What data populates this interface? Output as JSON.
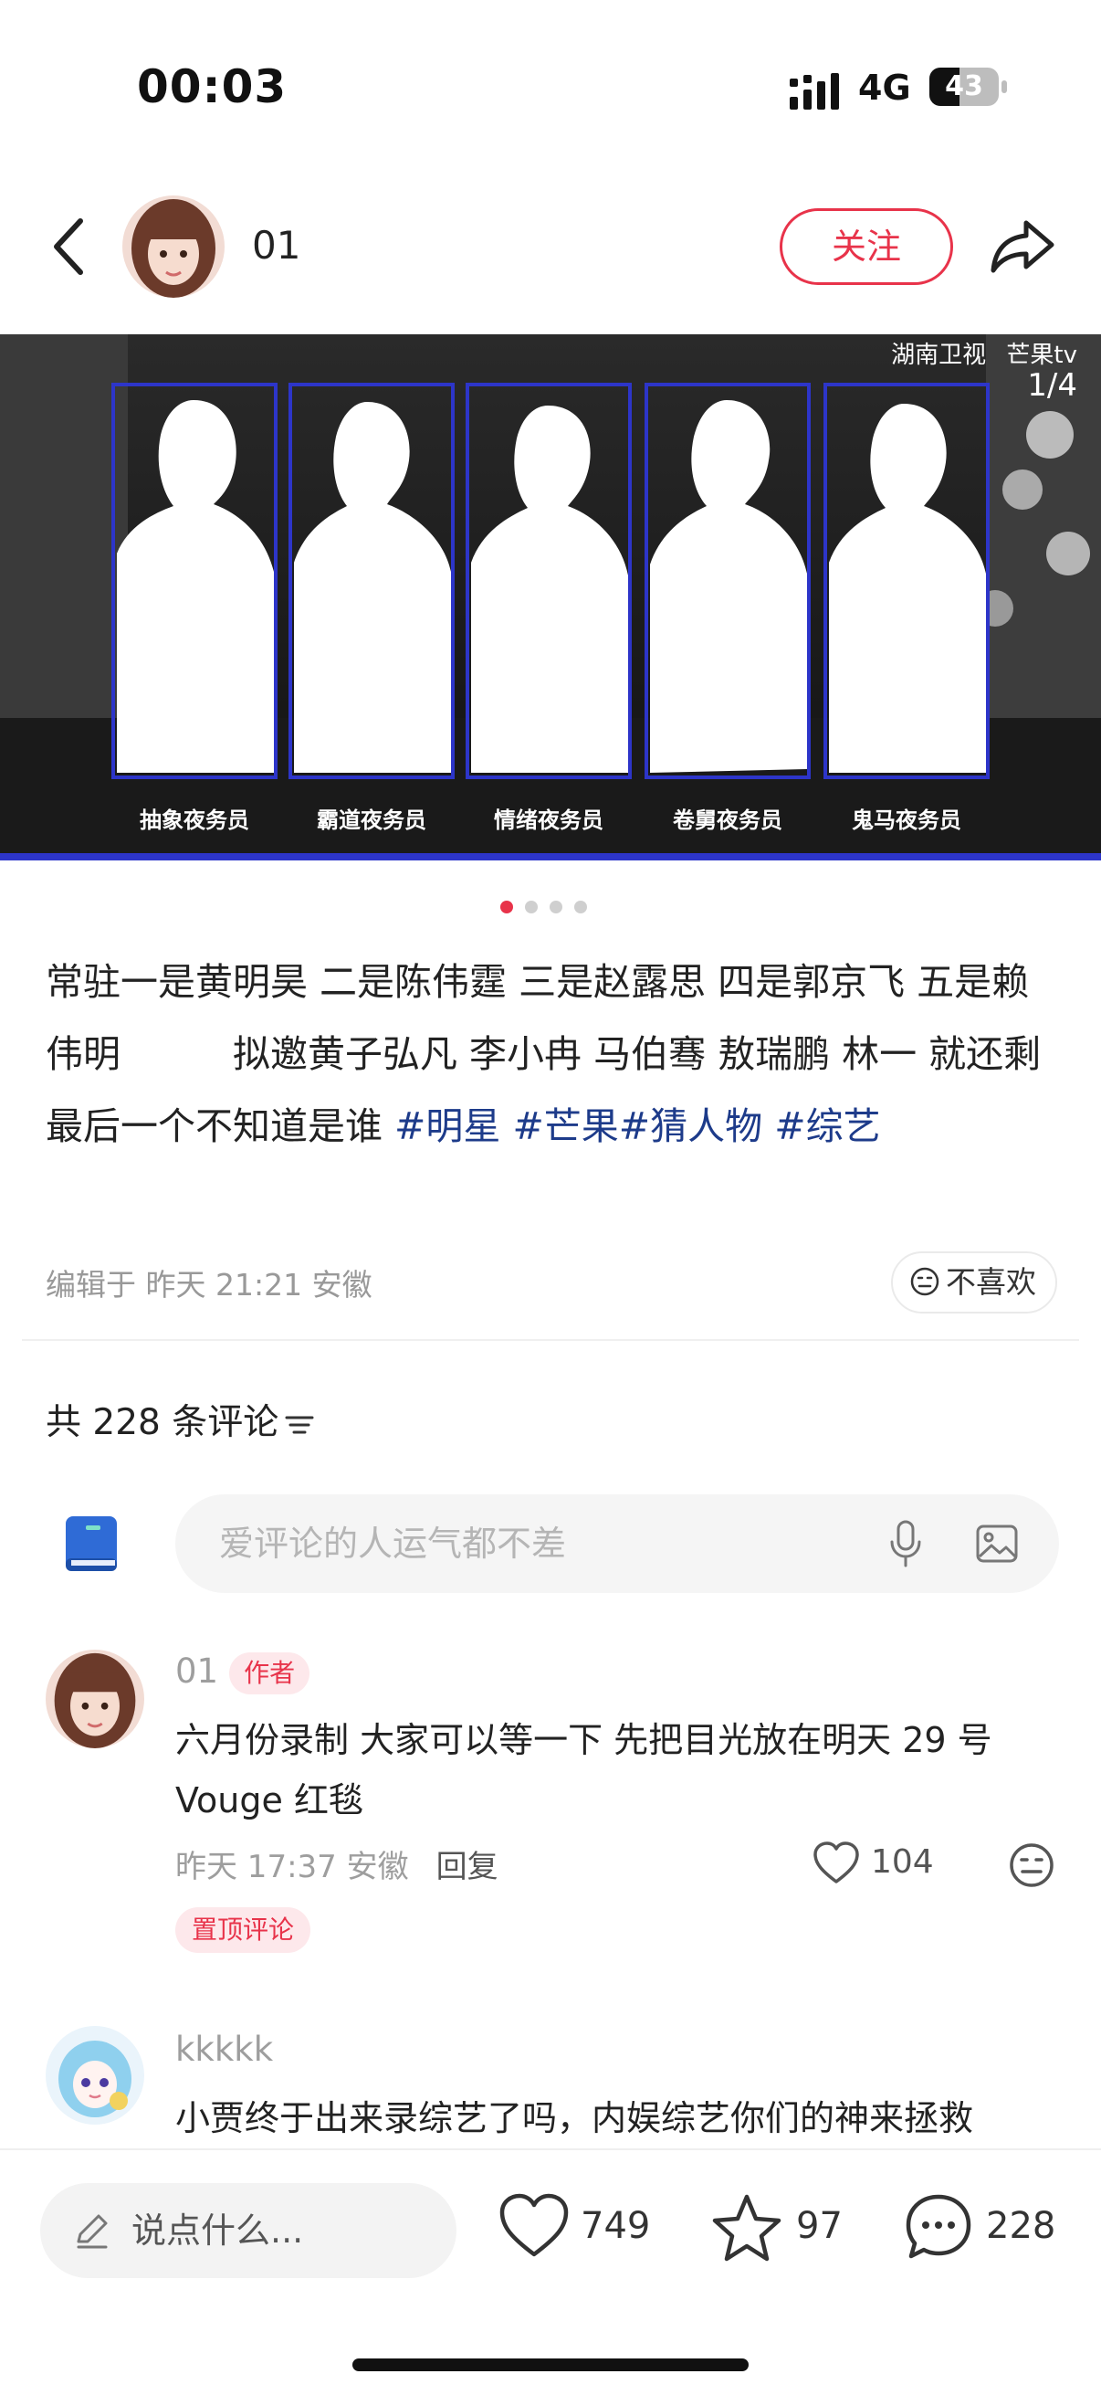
{
  "status_bar": {
    "time": "00:03",
    "network": "4G",
    "battery_level": "43",
    "battery_fraction": 0.43
  },
  "header": {
    "author_name": "01",
    "follow_label": "关注",
    "back_icon": "chevron-left-icon",
    "share_icon": "share-arrow-icon"
  },
  "hero": {
    "logo_left": "湖南卫视",
    "logo_right": "芒果tv",
    "counter": "1/4",
    "roles": [
      "抽象夜务员",
      "霸道夜务员",
      "情绪夜务员",
      "卷舅夜务员",
      "鬼马夜务员"
    ],
    "frame_color": "#2d35c9"
  },
  "carousel": {
    "total": 4,
    "active_index": 0
  },
  "post": {
    "text": "常驻一是黄明昊 二是陈伟霆 三是赵露思 四是郭京飞 五是赖伟明　　　拟邀黄子弘凡 李小冉 马伯骞 敖瑞鹏 林一 就还剩最后一个不知道是谁 ",
    "tags": [
      "#明星",
      "#芒果#猜人物",
      "#综艺"
    ],
    "meta": "编辑于 昨天 21:21 安徽",
    "dislike_label": "不喜欢"
  },
  "comments_section": {
    "count_label": "共 228 条评论",
    "input_placeholder": "爱评论的人运气都不差"
  },
  "comments": [
    {
      "name": "01",
      "badge": "作者",
      "text": "六月份录制  大家可以等一下  先把目光放在明天 29 号 Vouge 红毯",
      "time_location": "昨天 17:37 安徽",
      "reply_label": "回复",
      "likes": "104",
      "pinned_label": "置顶评论"
    },
    {
      "name": "kkkkk",
      "text": "小贾终于出来录综艺了吗，内娱综艺你们的神来拯救"
    }
  ],
  "bottom_bar": {
    "say_placeholder": "说点什么...",
    "likes": "749",
    "stars": "97",
    "comments": "228"
  },
  "colors": {
    "accent": "#e8334a",
    "tag": "#1d3b8a"
  }
}
